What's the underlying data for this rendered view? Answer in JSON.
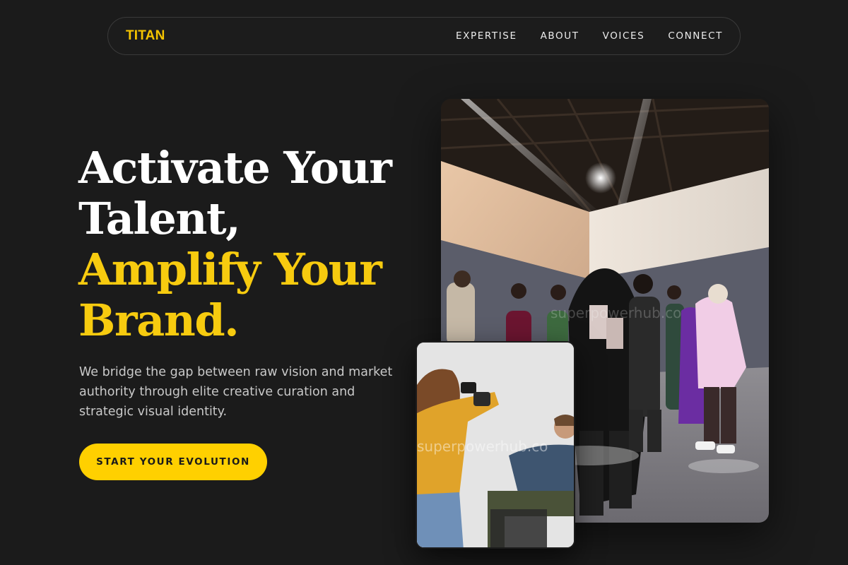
{
  "nav": {
    "brand": "TITAN",
    "links": [
      "EXPERTISE",
      "ABOUT",
      "VOICES",
      "CONNECT"
    ]
  },
  "hero": {
    "headline_white": [
      "Activate Your",
      "Talent,"
    ],
    "headline_gold": [
      "Amplify Your",
      "Brand."
    ],
    "description": "We bridge the gap between raw vision and market authority through elite creative curation and strategic visual identity.",
    "cta_label": "START YOUR EVOLUTION"
  },
  "images": {
    "main_watermark": "superpowerhub.co",
    "small_watermark": "superpowerhub.co"
  },
  "colors": {
    "background": "#1b1b1b",
    "accent": "#f7cb0f",
    "cta": "#ffd000",
    "text_muted": "#c9c9c9"
  }
}
